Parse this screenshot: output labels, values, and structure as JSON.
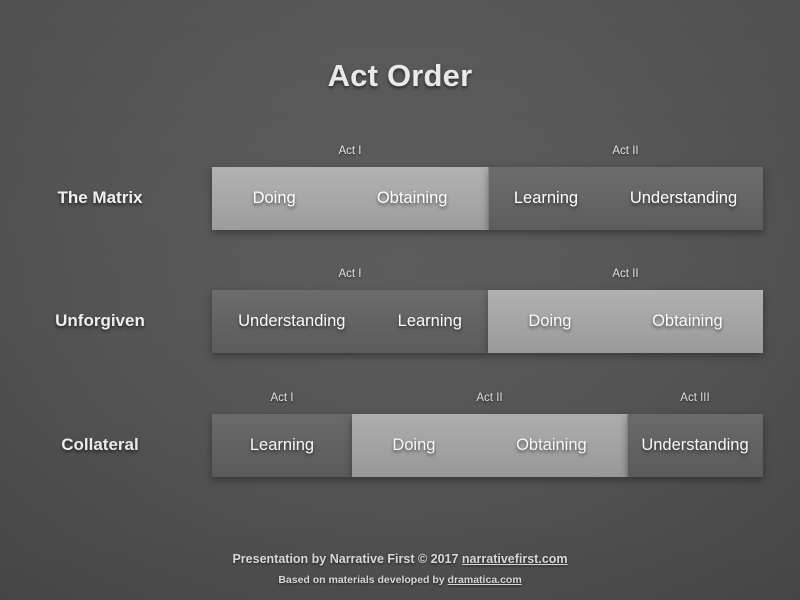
{
  "slide": {
    "title": "Act Order",
    "background_color": "#4f4f4f",
    "act_block_light_color": "#a9a9a9",
    "act_block_dark_color": "#666666"
  },
  "rows": [
    {
      "label": "The Matrix",
      "acts": [
        {
          "caption": "Act I",
          "shade": "light",
          "items": [
            "Doing",
            "Obtaining"
          ]
        },
        {
          "caption": "Act II",
          "shade": "dark",
          "items": [
            "Learning",
            "Understanding"
          ]
        }
      ]
    },
    {
      "label": "Unforgiven",
      "acts": [
        {
          "caption": "Act I",
          "shade": "dark",
          "items": [
            "Understanding",
            "Learning"
          ]
        },
        {
          "caption": "Act II",
          "shade": "light",
          "items": [
            "Doing",
            "Obtaining"
          ]
        }
      ]
    },
    {
      "label": "Collateral",
      "acts": [
        {
          "caption": "Act I",
          "shade": "dark",
          "items": [
            "Learning"
          ]
        },
        {
          "caption": "Act II",
          "shade": "light",
          "items": [
            "Doing",
            "Obtaining"
          ]
        },
        {
          "caption": "Act III",
          "shade": "dark",
          "items": [
            "Understanding"
          ]
        }
      ]
    }
  ],
  "footer": {
    "line1_prefix": "Presentation by Narrative First © 2017 ",
    "line1_link": "narrativefirst.com",
    "line2_prefix": "Based on materials developed by ",
    "line2_link": "dramatica.com"
  }
}
